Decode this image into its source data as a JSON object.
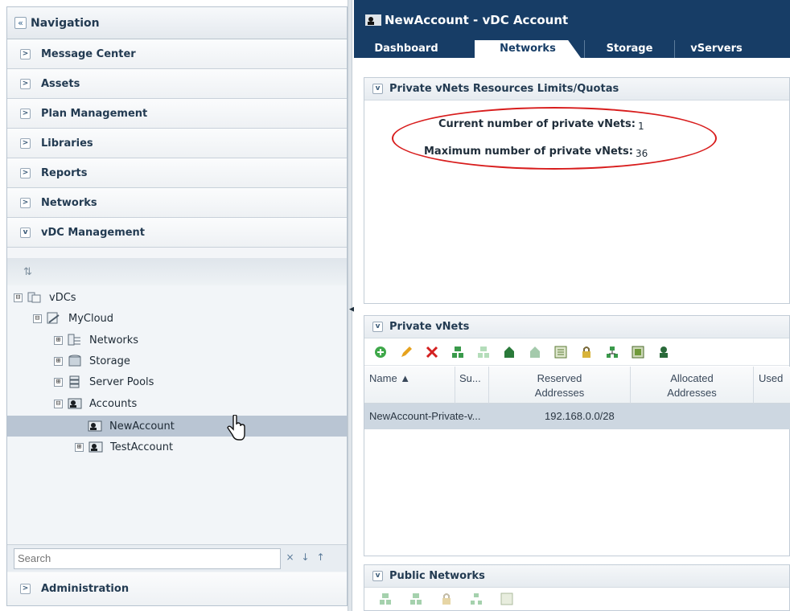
{
  "navigation": {
    "title": "Navigation",
    "collapse_glyph": "«",
    "sections": [
      {
        "label": "Message Center",
        "state": "collapsed"
      },
      {
        "label": "Assets",
        "state": "collapsed"
      },
      {
        "label": "Plan Management",
        "state": "collapsed"
      },
      {
        "label": "Libraries",
        "state": "collapsed"
      },
      {
        "label": "Reports",
        "state": "collapsed"
      },
      {
        "label": "Networks",
        "state": "collapsed"
      },
      {
        "label": "vDC Management",
        "state": "expanded"
      }
    ],
    "tree": [
      {
        "label": "vDCs",
        "expander": "⊟",
        "icon": "vdcs-icon"
      },
      {
        "label": "MyCloud",
        "expander": "⊟",
        "icon": "cloud-icon"
      },
      {
        "label": "Networks",
        "expander": "⊞",
        "icon": "networks-icon"
      },
      {
        "label": "Storage",
        "expander": "⊞",
        "icon": "storage-icon"
      },
      {
        "label": "Server Pools",
        "expander": "⊞",
        "icon": "server-pools-icon"
      },
      {
        "label": "Accounts",
        "expander": "⊟",
        "icon": "accounts-icon"
      },
      {
        "label": "NewAccount",
        "expander": "",
        "icon": "account-icon",
        "selected": true
      },
      {
        "label": "TestAccount",
        "expander": "⊞",
        "icon": "account-icon"
      }
    ],
    "search_placeholder": "Search",
    "search_buttons": [
      "×",
      "↓",
      "↑"
    ],
    "administration": "Administration"
  },
  "main": {
    "title": "NewAccount - vDC Account",
    "tabs": [
      {
        "label": "Dashboard",
        "active": false
      },
      {
        "label": "Networks",
        "active": true
      },
      {
        "label": "Storage",
        "active": false
      },
      {
        "label": "vServers",
        "active": false
      }
    ],
    "quotas": {
      "header": "Private vNets Resources Limits/Quotas",
      "current_label": "Current number of private vNets:",
      "current_value": "1",
      "max_label": "Maximum number of private vNets:",
      "max_value": "36"
    },
    "private_vnets": {
      "header": "Private vNets",
      "columns": [
        "Name ▲",
        "Su...",
        "Reserved Addresses",
        "Allocated Addresses",
        "Used"
      ],
      "rows": [
        {
          "name": "NewAccount-Private-v...",
          "subnet": "",
          "reserved": "192.168.0.0/28",
          "allocated": "",
          "used": ""
        }
      ]
    },
    "public_networks": {
      "header": "Public Networks"
    }
  },
  "colors": {
    "header_navy": "#173d66",
    "selection": "#b9c5d3",
    "highlight_ellipse": "#d81d1d"
  }
}
